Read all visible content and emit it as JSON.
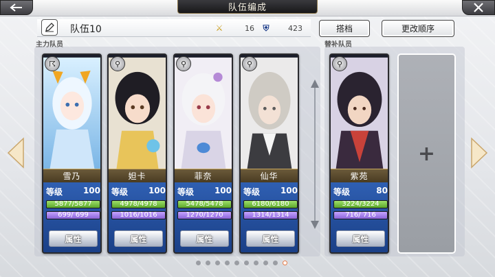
{
  "header": {
    "title": "队伍编成"
  },
  "team": {
    "name": "队伍10",
    "atk_value": "16",
    "def_value": "423",
    "atk_icon": "attack-stat-icon",
    "def_icon": "defense-stat-icon"
  },
  "buttons": {
    "partner": "搭档",
    "change_order": "更改顺序"
  },
  "sections": {
    "main": "主力队员",
    "sub": "替补队员"
  },
  "stat_labels": {
    "level": "等级",
    "attr": "属性"
  },
  "characters": [
    {
      "name": "雪乃",
      "level": "100",
      "hp": "5877/5877",
      "mp": "699/ 699",
      "badge": "☈"
    },
    {
      "name": "妲卡",
      "level": "100",
      "hp": "4978/4978",
      "mp": "1016/1016",
      "badge": "⚲"
    },
    {
      "name": "菲奈",
      "level": "100",
      "hp": "5478/5478",
      "mp": "1270/1270",
      "badge": "⚲"
    },
    {
      "name": "仙华",
      "level": "100",
      "hp": "6180/6180",
      "mp": "1314/1314",
      "badge": "⚲"
    },
    {
      "name": "紫苑",
      "level": "80",
      "hp": "3224/3224",
      "mp": "716/ 716",
      "badge": "⚲"
    }
  ],
  "empty_slot": {
    "symbol": "+"
  },
  "pagination": {
    "total": 10,
    "active_index": 9
  },
  "colors": {
    "hp_bar": "#5ba72a",
    "mp_bar": "#8a63d8",
    "stats_panel": "#2f5fb2"
  }
}
